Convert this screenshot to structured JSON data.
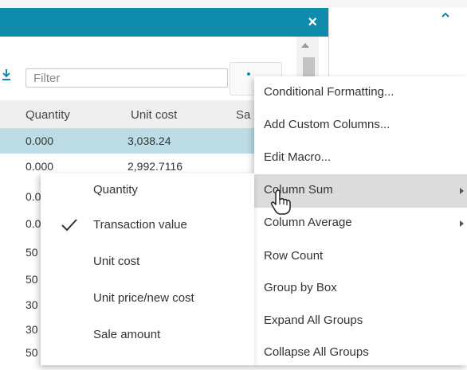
{
  "dialog": {
    "close_glyph": "×",
    "filter_placeholder": "Filter",
    "more_glyph": "•"
  },
  "table": {
    "headers": [
      "Quantity",
      "Unit cost",
      "Sa"
    ],
    "rows": [
      [
        "0.000",
        "3,038.24"
      ],
      [
        "0.000",
        "2,992.7116"
      ],
      [
        "0.0",
        ""
      ],
      [
        "0.0",
        ""
      ],
      [
        "50",
        ""
      ],
      [
        "50",
        ""
      ],
      [
        "30",
        ""
      ],
      [
        "30",
        ""
      ],
      [
        "50",
        ""
      ]
    ]
  },
  "context_menu": {
    "items": [
      {
        "label": "Conditional Formatting..."
      },
      {
        "label": "Add Custom Columns..."
      },
      {
        "label": "Edit Macro..."
      },
      {
        "label": "Column Sum",
        "has_submenu": true,
        "hovered": true
      },
      {
        "label": "Column Average",
        "has_submenu": true
      },
      {
        "label": "Row Count"
      },
      {
        "label": "Group by Box"
      },
      {
        "label": "Expand All Groups"
      },
      {
        "label": "Collapse All Groups"
      }
    ]
  },
  "submenu": {
    "items": [
      {
        "label": "Quantity",
        "checked": false
      },
      {
        "label": "Transaction value",
        "checked": true
      },
      {
        "label": "Unit cost",
        "checked": false
      },
      {
        "label": "Unit price/new cost",
        "checked": false
      },
      {
        "label": "Sale amount",
        "checked": false
      }
    ]
  },
  "colors": {
    "title_bar": "#0f8cab",
    "selected_row": "#bcdde5",
    "menu_hover": "#dcdcdc"
  },
  "icons": [
    "close-icon",
    "download-icon",
    "more-icon",
    "collapse-icon",
    "checkmark-icon",
    "submenu-arrow-icon",
    "hand-cursor-icon",
    "scroll-up-icon"
  ]
}
